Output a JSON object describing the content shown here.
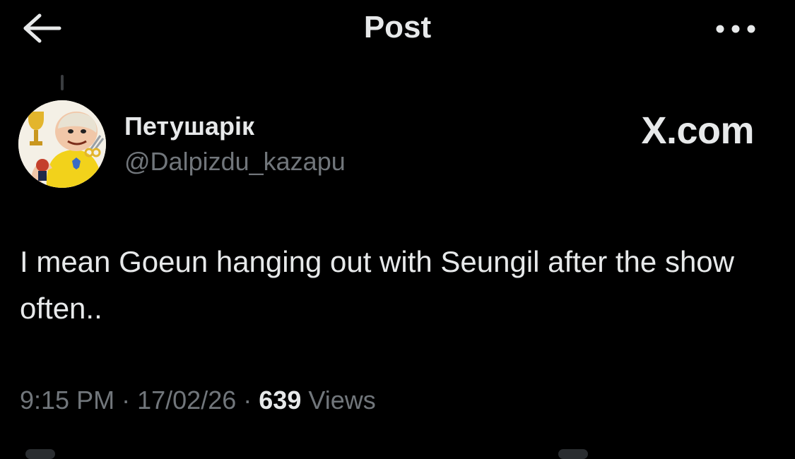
{
  "header": {
    "title": "Post",
    "back_icon": "arrow-left-icon",
    "more_icon": "more-horizontal-icon"
  },
  "author": {
    "display_name": "Петушарік",
    "handle": "@Dalpizdu_kazapu",
    "avatar_icon": "cartoon-avatar"
  },
  "brand": {
    "logo_text": "X.com"
  },
  "post": {
    "text": "I mean Goeun hanging out with Seungil after the show often..",
    "time": "9:15 PM",
    "date": "17/02/26",
    "views_count": "639",
    "views_label": "Views",
    "separator": "·"
  },
  "colors": {
    "background": "#000000",
    "primary_text": "#e7e9ea",
    "secondary_text": "#71767b"
  }
}
